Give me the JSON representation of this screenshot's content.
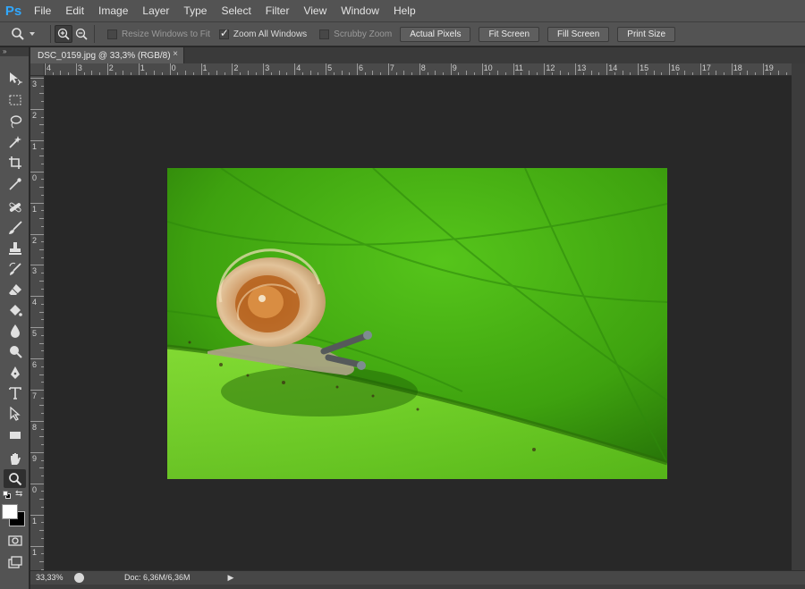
{
  "app": {
    "logo": "Ps"
  },
  "menu": [
    "File",
    "Edit",
    "Image",
    "Layer",
    "Type",
    "Select",
    "Filter",
    "View",
    "Window",
    "Help"
  ],
  "options": {
    "resize_windows": {
      "label": "Resize Windows to Fit",
      "checked": false
    },
    "zoom_all": {
      "label": "Zoom All Windows",
      "checked": true
    },
    "scrubby": {
      "label": "Scrubby Zoom",
      "checked": false
    },
    "buttons": [
      "Actual Pixels",
      "Fit Screen",
      "Fill Screen",
      "Print Size"
    ]
  },
  "document": {
    "tab_title": "DSC_0159.jpg @ 33,3% (RGB/8)",
    "close_glyph": "×"
  },
  "rulers": {
    "h_labels": [
      "4",
      "3",
      "2",
      "1",
      "0",
      "1",
      "2",
      "3",
      "4",
      "5",
      "6",
      "7",
      "8",
      "9",
      "10",
      "11",
      "12",
      "13",
      "14",
      "15",
      "16",
      "17",
      "18",
      "19"
    ],
    "v_labels": [
      "3",
      "2",
      "1",
      "0",
      "1",
      "2",
      "3",
      "4",
      "5",
      "6",
      "7",
      "8",
      "9",
      "0",
      "1",
      "1"
    ]
  },
  "status": {
    "zoom": "33,33%",
    "doc": "Doc: 6,36M/6,36M",
    "arrow": "▶"
  },
  "tools": [
    "move-icon",
    "marquee-icon",
    "lasso-icon",
    "quick-select-icon",
    "crop-icon",
    "eyedropper-icon",
    "healing-icon",
    "brush-icon",
    "stamp-icon",
    "history-brush-icon",
    "eraser-icon",
    "bucket-icon",
    "blur-icon",
    "dodge-icon",
    "pen-icon",
    "type-icon",
    "path-select-icon",
    "rectangle-icon",
    "hand-icon",
    "zoom-icon"
  ],
  "colors": {
    "foreground": "#ffffff",
    "background": "#000000",
    "accent": "#31a8ff"
  }
}
